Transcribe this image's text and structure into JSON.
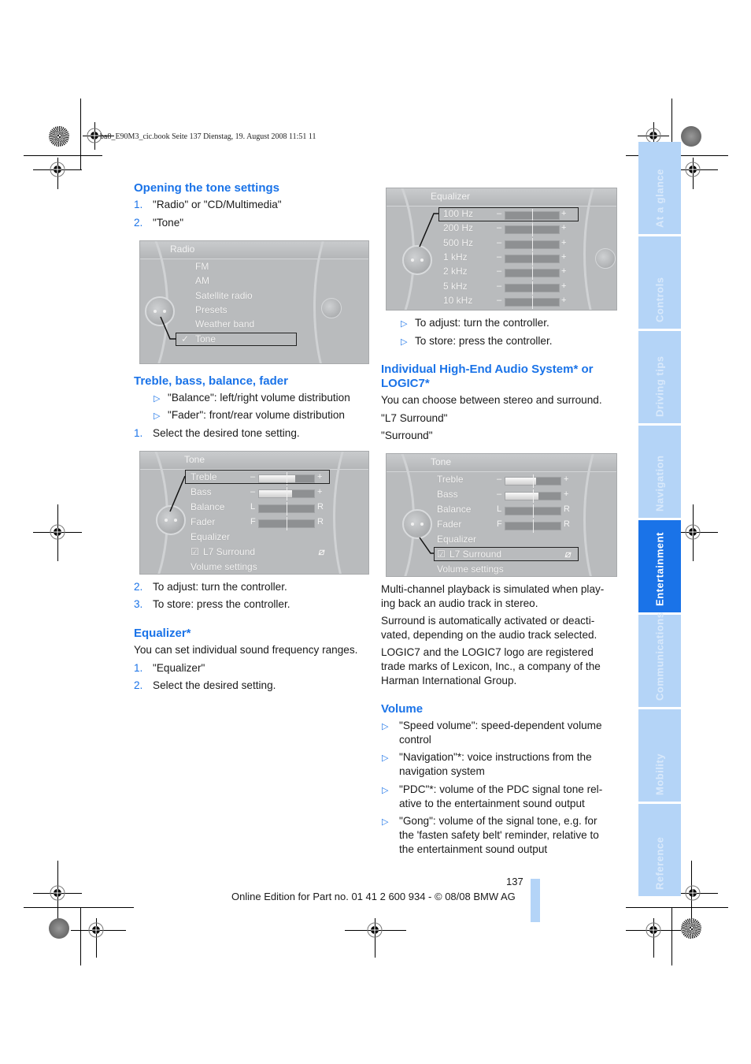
{
  "header": {
    "print_info": "ba8_E90M3_cic.book  Seite 137  Dienstag, 19. August 2008  11:51 11"
  },
  "left_column": {
    "section1": {
      "heading": "Opening the tone settings",
      "steps": [
        {
          "num": "1.",
          "text": "\"Radio\" or \"CD/Multimedia\""
        },
        {
          "num": "2.",
          "text": "\"Tone\""
        }
      ]
    },
    "radio_screen": {
      "title": "Radio",
      "items": [
        "FM",
        "AM",
        "Satellite radio",
        "Presets",
        "Weather band",
        "Tone"
      ],
      "selected": "Tone",
      "check_mark": "✓"
    },
    "section2": {
      "heading": "Treble, bass, balance, fader",
      "bullets": [
        "\"Balance\": left/right volume distribution",
        "\"Fader\": front/rear volume distribution"
      ],
      "steps": [
        {
          "num": "1.",
          "text": "Select the desired tone setting."
        }
      ]
    },
    "tone_screen": {
      "title": "Tone",
      "rows": [
        {
          "label": "Treble",
          "left": "–",
          "right": "+",
          "value": 0.65
        },
        {
          "label": "Bass",
          "left": "–",
          "right": "+",
          "value": 0.6
        },
        {
          "label": "Balance",
          "left": "L",
          "right": "R",
          "value": 0.5
        },
        {
          "label": "Fader",
          "left": "F",
          "right": "R",
          "value": 0.5
        }
      ],
      "items": [
        "Equalizer",
        "L7 Surround",
        "Volume settings"
      ],
      "selected": "Treble"
    },
    "steps_after": [
      {
        "num": "2.",
        "text": "To adjust: turn the controller."
      },
      {
        "num": "3.",
        "text": "To store: press the controller."
      }
    ],
    "section3": {
      "heading": "Equalizer*",
      "intro": "You can set individual sound frequency ranges.",
      "steps": [
        {
          "num": "1.",
          "text": "\"Equalizer\""
        },
        {
          "num": "2.",
          "text": "Select the desired setting."
        }
      ]
    }
  },
  "right_column": {
    "equalizer_screen": {
      "title": "Equalizer",
      "bands": [
        {
          "label": "100 Hz",
          "value": 0.5
        },
        {
          "label": "200 Hz",
          "value": 0.5
        },
        {
          "label": "500 Hz",
          "value": 0.5
        },
        {
          "label": "1 kHz",
          "value": 0.5
        },
        {
          "label": "2 kHz",
          "value": 0.5
        },
        {
          "label": "5 kHz",
          "value": 0.5
        },
        {
          "label": "10 kHz",
          "value": 0.5
        }
      ],
      "minus": "–",
      "plus": "+",
      "selected": "100 Hz"
    },
    "eq_bullets": [
      "To adjust: turn the controller.",
      "To store: press the controller."
    ],
    "section4": {
      "heading_line1": "Individual High-End Audio System* or",
      "heading_line2": "LOGIC7*",
      "intro": "You can choose between stereo and surround.",
      "options": [
        "\"L7 Surround\"",
        "\"Surround\""
      ]
    },
    "tone_screen2": {
      "title": "Tone",
      "rows": [
        {
          "label": "Treble",
          "left": "–",
          "right": "+",
          "value": 0.55
        },
        {
          "label": "Bass",
          "left": "–",
          "right": "+",
          "value": 0.6
        },
        {
          "label": "Balance",
          "left": "L",
          "right": "R",
          "value": 0.5
        },
        {
          "label": "Fader",
          "left": "F",
          "right": "R",
          "value": 0.5
        }
      ],
      "items": [
        "Equalizer",
        "L7 Surround",
        "Volume settings"
      ],
      "selected": "L7 Surround"
    },
    "paragraphs": [
      [
        "Multi-channel playback is simulated when play-",
        "ing back an audio track in stereo."
      ],
      [
        "Surround is automatically activated or deacti-",
        "vated, depending on the audio track selected."
      ],
      [
        "LOGIC7 and the LOGIC7 logo are registered",
        "trade marks of Lexicon, Inc., a company of the",
        "Harman International Group."
      ]
    ],
    "section5": {
      "heading": "Volume",
      "bullets": [
        [
          "\"Speed volume\": speed-dependent volume",
          "control"
        ],
        [
          "\"Navigation\"*: voice instructions from the",
          "navigation system"
        ],
        [
          "\"PDC\"*: volume of the PDC signal tone rel-",
          "ative to the entertainment sound output"
        ],
        [
          "\"Gong\": volume of the signal tone, e.g. for",
          "the 'fasten safety belt' reminder, relative to",
          "the entertainment sound output"
        ]
      ]
    }
  },
  "side_tabs": [
    {
      "label": "At a glance",
      "active": false
    },
    {
      "label": "Controls",
      "active": false
    },
    {
      "label": "Driving tips",
      "active": false
    },
    {
      "label": "Navigation",
      "active": false
    },
    {
      "label": "Entertainment",
      "active": true
    },
    {
      "label": "Communications",
      "active": false
    },
    {
      "label": "Mobility",
      "active": false
    },
    {
      "label": "Reference",
      "active": false
    }
  ],
  "footer": {
    "page_number": "137",
    "edition": "Online Edition for Part no. 01 41 2 600 934 - © 08/08 BMW AG"
  },
  "colors": {
    "accent": "#1a73e8",
    "tab_inactive": "#b4d4f7",
    "tab_active": "#1a73e8"
  }
}
